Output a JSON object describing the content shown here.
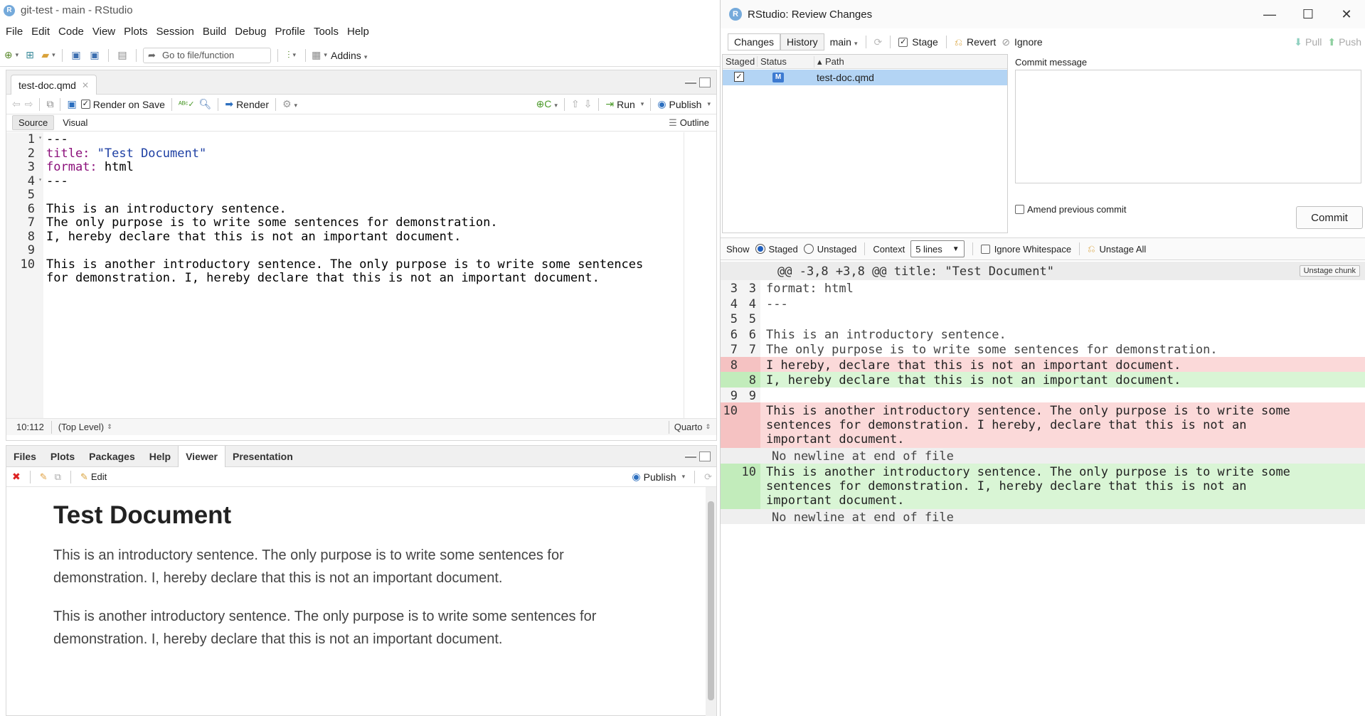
{
  "main": {
    "title": "git-test - main - RStudio",
    "menu": [
      "File",
      "Edit",
      "Code",
      "View",
      "Plots",
      "Session",
      "Build",
      "Debug",
      "Profile",
      "Tools",
      "Help"
    ],
    "toolbar": {
      "goto_placeholder": "Go to file/function",
      "addins": "Addins"
    },
    "editor": {
      "tab": "test-doc.qmd",
      "render_on_save": "Render on Save",
      "render": "Render",
      "run": "Run",
      "publish": "Publish",
      "source": "Source",
      "visual": "Visual",
      "outline": "Outline",
      "lines": [
        {
          "n": "1",
          "code": "---"
        },
        {
          "n": "2",
          "key": "title:",
          "val": " \"Test Document\""
        },
        {
          "n": "3",
          "key": "format:",
          "rest": " html"
        },
        {
          "n": "4",
          "code": "---"
        },
        {
          "n": "5",
          "code": ""
        },
        {
          "n": "6",
          "code": "This is an introductory sentence."
        },
        {
          "n": "7",
          "code": "The only purpose is to write some sentences for demonstration."
        },
        {
          "n": "8",
          "code": "I, hereby declare that this is not an important document."
        },
        {
          "n": "9",
          "code": ""
        },
        {
          "n": "10",
          "code": "This is another introductory sentence. The only purpose is to write some sentences"
        },
        {
          "n": "",
          "code": "for demonstration. I, hereby declare that this is not an important document."
        }
      ],
      "status_pos": "10:112",
      "status_scope": "(Top Level)",
      "status_mode": "Quarto"
    },
    "viewer": {
      "tabs": [
        "Files",
        "Plots",
        "Packages",
        "Help",
        "Viewer",
        "Presentation"
      ],
      "active_tab": "Viewer",
      "edit": "Edit",
      "publish": "Publish",
      "heading": "Test Document",
      "para1": "This is an introductory sentence. The only purpose is to write some sentences for demonstration. I, hereby declare that this is not an important document.",
      "para2": "This is another introductory sentence. The only purpose is to write some sentences for demonstration. I, hereby declare that this is not an important document."
    }
  },
  "review": {
    "title": "RStudio: Review Changes",
    "changes": "Changes",
    "history": "History",
    "branch": "main",
    "stage": "Stage",
    "revert": "Revert",
    "ignore": "Ignore",
    "pull": "Pull",
    "push": "Push",
    "cols": {
      "staged": "Staged",
      "status": "Status",
      "path": "Path"
    },
    "file": {
      "status": "M",
      "path": "test-doc.qmd"
    },
    "commit_label": "Commit message",
    "amend": "Amend previous commit",
    "commit": "Commit",
    "show": "Show",
    "staged": "Staged",
    "unstaged": "Unstaged",
    "context": "Context",
    "context_value": "5 lines",
    "ignore_ws": "Ignore Whitespace",
    "unstage_all": "Unstage All",
    "hunk": "@@ -3,8 +3,8 @@ title: \"Test Document\"",
    "unstage_chunk": "Unstage chunk",
    "diff": [
      {
        "kind": "ctx",
        "o": "3",
        "n": "3",
        "text": "format: html"
      },
      {
        "kind": "ctx",
        "o": "4",
        "n": "4",
        "text": "---"
      },
      {
        "kind": "ctx",
        "o": "5",
        "n": "5",
        "text": ""
      },
      {
        "kind": "ctx",
        "o": "6",
        "n": "6",
        "text": "This is an introductory sentence."
      },
      {
        "kind": "ctx",
        "o": "7",
        "n": "7",
        "text": "The only purpose is to write some sentences for demonstration."
      },
      {
        "kind": "del",
        "o": "8",
        "n": "",
        "text": "I hereby, declare that this is not an important document."
      },
      {
        "kind": "add",
        "o": "",
        "n": "8",
        "text": "I, hereby declare that this is not an important document."
      },
      {
        "kind": "ctx",
        "o": "9",
        "n": "9",
        "text": ""
      },
      {
        "kind": "del",
        "o": "10",
        "n": "",
        "text": "This is another introductory sentence. The only purpose is to write some\nsentences for demonstration. I hereby, declare that this is not an\nimportant document."
      },
      {
        "kind": "eof",
        "o": "",
        "n": "",
        "text": "No newline at end of file"
      },
      {
        "kind": "add",
        "o": "",
        "n": "10",
        "text": "This is another introductory sentence. The only purpose is to write some\nsentences for demonstration. I, hereby declare that this is not an\nimportant document."
      },
      {
        "kind": "eof",
        "o": "",
        "n": "",
        "text": "No newline at end of file"
      }
    ]
  }
}
